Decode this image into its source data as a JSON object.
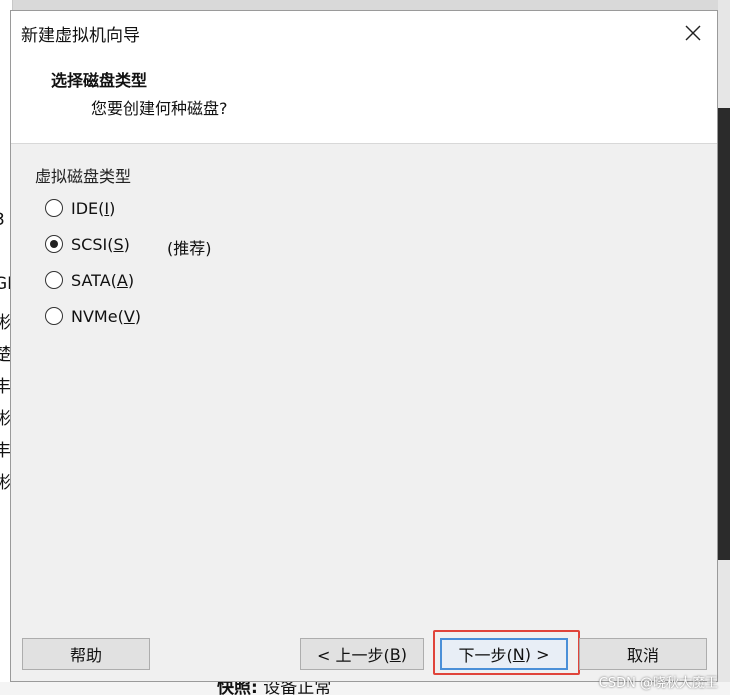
{
  "background": {
    "left_fragments": [
      "3",
      "GI",
      "彬",
      "楚",
      "丰",
      "彬",
      "丰",
      "彬"
    ],
    "status_label": "快照:",
    "status_value": "设备正常"
  },
  "dialog": {
    "title": "新建虚拟机向导",
    "close_icon": "close-icon",
    "header": {
      "title": "选择磁盘类型",
      "subtitle": "您要创建何种磁盘?"
    },
    "group_label": "虚拟磁盘类型",
    "options": [
      {
        "label": "IDE(",
        "key": "I",
        "suffix": ")",
        "checked": false
      },
      {
        "label": "SCSI(",
        "key": "S",
        "suffix": ")",
        "checked": true
      },
      {
        "label": "SATA(",
        "key": "A",
        "suffix": ")",
        "checked": false
      },
      {
        "label": "NVMe(",
        "key": "V",
        "suffix": ")",
        "checked": false
      }
    ],
    "recommend_label": "(推荐)",
    "buttons": {
      "help": "帮助",
      "back_prefix": "< 上一步(",
      "back_key": "B",
      "back_suffix": ")",
      "next_prefix": "下一步(",
      "next_key": "N",
      "next_suffix": ") >",
      "cancel": "取消"
    },
    "accent_color": "#e0443a"
  },
  "watermark": "CSDN @晓秋大魔王"
}
